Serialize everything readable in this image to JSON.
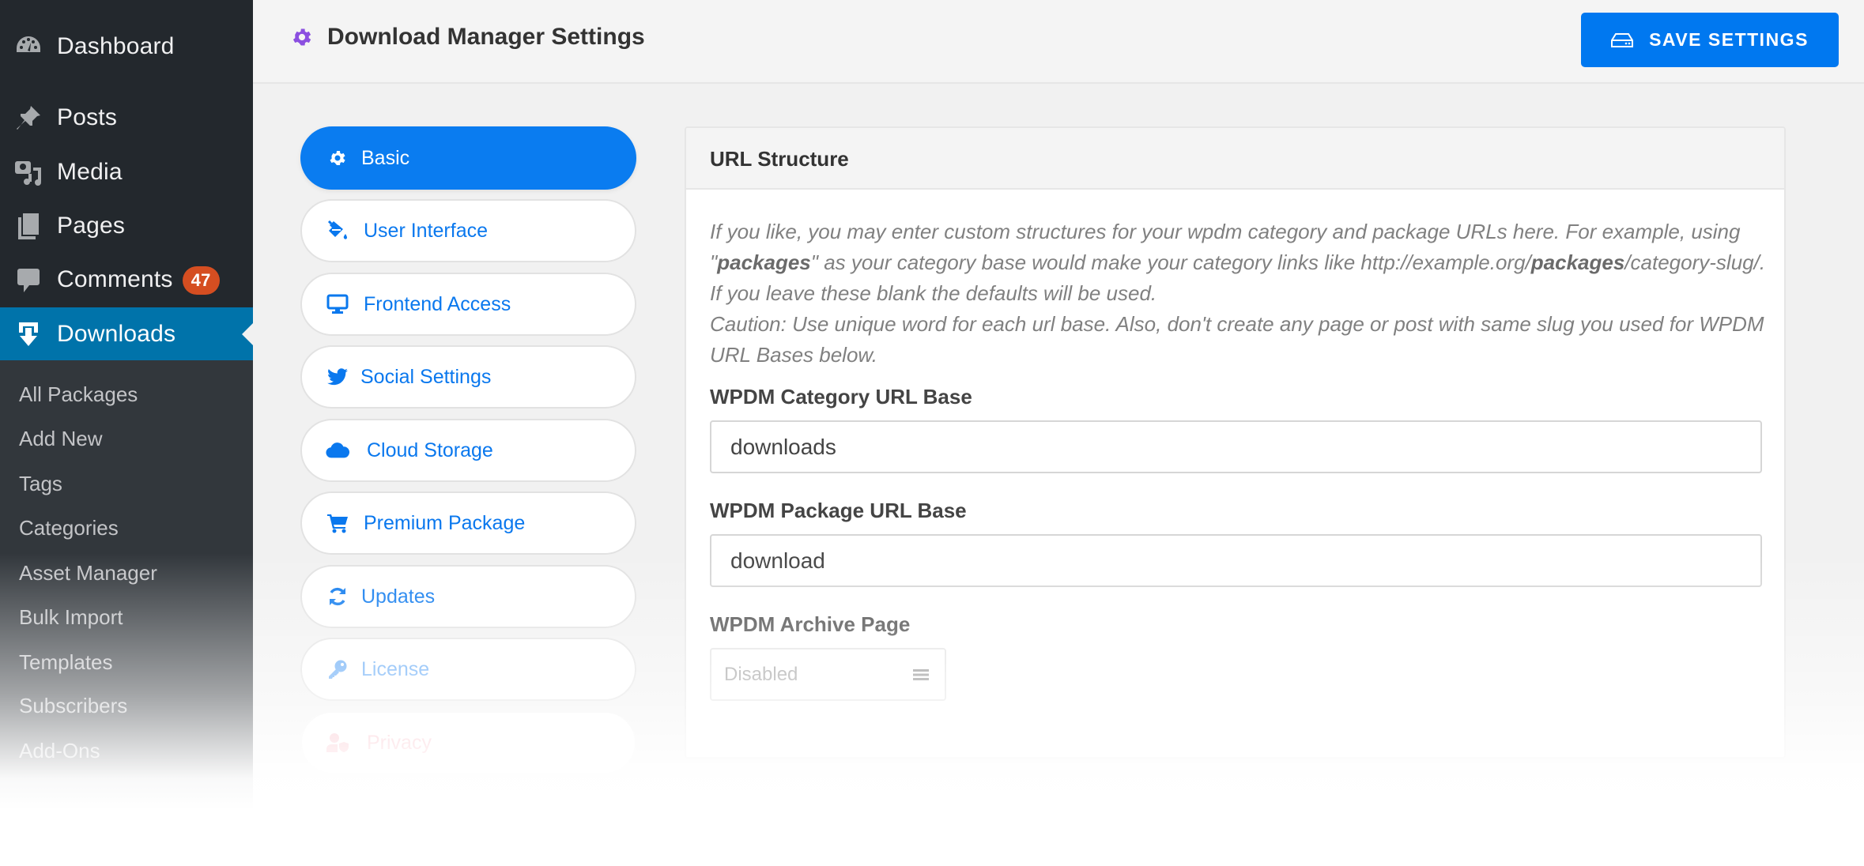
{
  "sidebar": {
    "menu": [
      {
        "label": "Dashboard",
        "icon": "dashboard-icon"
      },
      {
        "label": "Posts",
        "icon": "pin-icon"
      },
      {
        "label": "Media",
        "icon": "media-icon"
      },
      {
        "label": "Pages",
        "icon": "pages-icon"
      },
      {
        "label": "Comments",
        "icon": "comment-icon",
        "badge": "47"
      },
      {
        "label": "Downloads",
        "icon": "download-icon",
        "active": true
      }
    ],
    "submenu": [
      "All Packages",
      "Add New",
      "Tags",
      "Categories",
      "Asset Manager",
      "Bulk Import",
      "Templates",
      "Subscribers",
      "Add-Ons"
    ]
  },
  "header": {
    "title": "Download Manager Settings",
    "save_label": "SAVE SETTINGS"
  },
  "settings_nav": [
    {
      "label": "Basic",
      "icon": "gear-icon",
      "active": true
    },
    {
      "label": "User Interface",
      "icon": "paint-bucket-icon"
    },
    {
      "label": "Frontend Access",
      "icon": "desktop-icon"
    },
    {
      "label": "Social Settings",
      "icon": "twitter-icon"
    },
    {
      "label": "Cloud Storage",
      "icon": "cloud-icon"
    },
    {
      "label": "Premium Package",
      "icon": "cart-icon"
    },
    {
      "label": "Updates",
      "icon": "sync-icon"
    },
    {
      "label": "License",
      "icon": "key-icon"
    },
    {
      "label": "Privacy",
      "icon": "user-shield-icon"
    }
  ],
  "panel": {
    "title": "URL Structure",
    "description": {
      "p1": "If you like, you may enter custom structures for your wpdm category and package URLs here. For example, using \"",
      "p1_bold": "packages",
      "p2": "\" as your category base would make your category links like http://example.org/",
      "p2_bold": "packages",
      "p3": "/category-slug/. If you leave these blank the defaults will be used.",
      "caution": "Caution: Use unique word for each url base. Also, don't create any page or post with same slug you used for WPDM URL Bases below."
    },
    "fields": {
      "category_base": {
        "label": "WPDM Category URL Base",
        "value": "downloads"
      },
      "package_base": {
        "label": "WPDM Package URL Base",
        "value": "download"
      },
      "archive_page": {
        "label": "WPDM Archive Page",
        "value": "Disabled"
      }
    }
  },
  "colors": {
    "accent": "#0a7cf0",
    "wp_active": "#0073aa",
    "badge": "#d54e21",
    "title_gear": "#8b4fe0"
  }
}
